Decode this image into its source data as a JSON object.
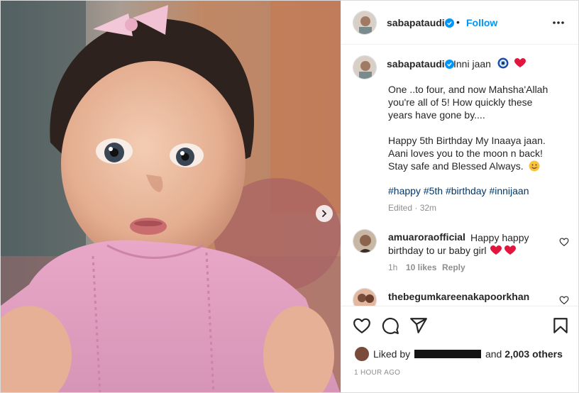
{
  "header": {
    "username": "sabapataudi",
    "separator": "•",
    "follow_label": "Follow",
    "more_icon": "more-horizontal-icon"
  },
  "caption": {
    "username": "sabapataudi",
    "first_line": "Inni jaan",
    "emoji": [
      "nazar-amulet-icon",
      "red-heart-icon"
    ],
    "paragraph1": [
      "One ..to four, and now Mahsha'Allah",
      "you're all of 5! How quickly these",
      "years have gone by...."
    ],
    "paragraph2": [
      "Happy 5th Birthday My Inaaya jaan.",
      "Aani loves you to the moon n back!",
      "Stay safe and Blessed Always."
    ],
    "hashtags": [
      "#happy",
      "#5th",
      "#birthday",
      "#innijaan"
    ],
    "edited": "Edited · 32m"
  },
  "comments": [
    {
      "username": "amuaroraofficial",
      "text_line1": "Happy happy",
      "text_line2": "birthday to ur baby girl",
      "time": "1h",
      "likes": "10 likes",
      "reply": "Reply"
    },
    {
      "username": "thebegumkareenakapoorkhan"
    }
  ],
  "actions": {
    "icons": [
      "heart-icon",
      "comment-icon",
      "share-icon",
      "bookmark-icon"
    ]
  },
  "likes": {
    "prefix": "Liked by",
    "conjunction": "and",
    "others": "2,003 others"
  },
  "timestamp": "1 HOUR AGO",
  "colors": {
    "accent": "#0095f6",
    "hashtag": "#00376b",
    "heart": "#ed4956",
    "muted": "#8e8e8e",
    "verified": "#0095f6"
  }
}
